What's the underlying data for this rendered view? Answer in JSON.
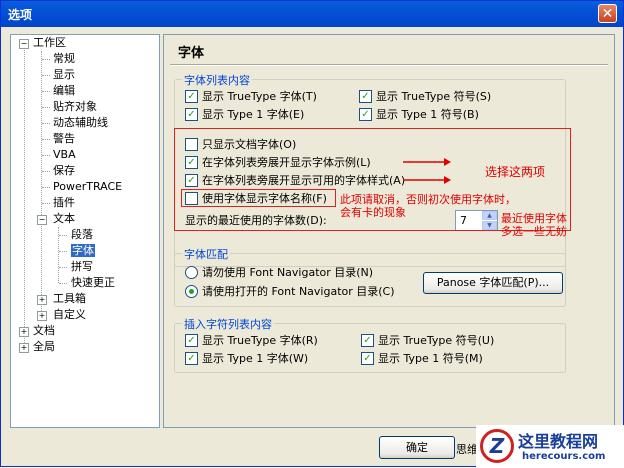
{
  "window": {
    "title": "选项",
    "close_glyph": "✕"
  },
  "tree": {
    "root1": "工作区",
    "ws_items": [
      "常规",
      "显示",
      "编辑",
      "贴齐对象",
      "动态辅助线",
      "警告",
      "VBA",
      "保存",
      "PowerTRACE",
      "插件"
    ],
    "text_node": "文本",
    "text_children": [
      "段落",
      "字体",
      "拼写",
      "快速更正"
    ],
    "toolbox": "工具箱",
    "custom": "自定义",
    "doc": "文档",
    "global": "全局"
  },
  "panel": {
    "title": "字体",
    "list_group": {
      "legend": "字体列表内容",
      "show_tt_font": "显示 TrueType 字体(T)",
      "show_tt_symbol": "显示 TrueType 符号(S)",
      "show_t1_font": "显示 Type 1 字体(E)",
      "show_t1_symbol": "显示 Type 1 符号(B)",
      "only_doc_fonts": "只显示文档字体(O)",
      "show_examples": "在字体列表旁展开显示字体示例(L)",
      "show_styles": "在字体列表旁展开显示可用的字体样式(A)",
      "use_font_names": "使用字体显示字体名称(F)",
      "recent_label": "显示的最近使用的字体数(D):",
      "recent_value": "7"
    },
    "match_group": {
      "legend": "字体匹配",
      "ask_fn": "请勿使用 Font Navigator 目录(N)",
      "use_fn": "请使用打开的 Font Navigator 目录(C)",
      "panose_button": "Panose 字体匹配(P)..."
    },
    "insert_group": {
      "legend": "插入字符列表内容",
      "show_tt_font": "显示 TrueType 字体(R)",
      "show_tt_symbol": "显示 TrueType 符号(U)",
      "show_t1_font": "显示 Type 1 字体(W)",
      "show_t1_symbol": "显示 Type 1 符号(M)"
    }
  },
  "annotations": {
    "select_two": "选择这两项",
    "uncheck_note_1": "此项请取消，否则初次使用字体时，",
    "uncheck_note_2": "会有卡的现象",
    "recent_note_1": "最近使用字体",
    "recent_note_2": "多选一些无妨"
  },
  "footer": {
    "ok_button": "确定",
    "partial_text": "思维"
  },
  "watermark": {
    "logo_letter": "Z",
    "title": "这里教程网",
    "url": "herecours.com"
  },
  "colors": {
    "accent": "#0046d5",
    "annotation": "#e00000",
    "selection": "#316ac5",
    "check": "#21a121"
  }
}
